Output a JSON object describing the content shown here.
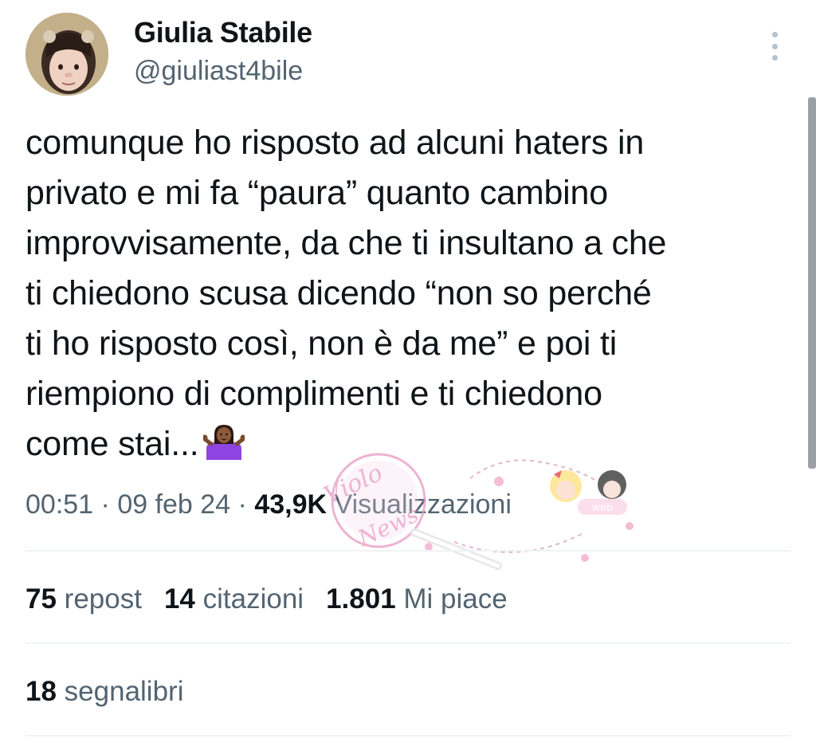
{
  "author": {
    "display_name": "Giulia Stabile",
    "handle": "@giuliast4bile"
  },
  "tweet": {
    "lines": [
      "comunque ho risposto ad alcuni haters in",
      "privato e mi fa “paura” quanto cambino",
      "improvvisamente, da che ti insultano a che",
      "ti chiedono scusa dicendo “non so perché",
      "ti ho risposto così, non è da me” e poi ti",
      "riempiono di complimenti e ti chiedono",
      "come stai..."
    ],
    "emoji": "person-shrugging-emoji"
  },
  "meta": {
    "time": "00:51",
    "separator": " · ",
    "date": "09 feb 24",
    "views_count": "43,9K",
    "views_label": "Visualizzazioni"
  },
  "stats": {
    "reposts": {
      "count": "75",
      "label": "repost"
    },
    "quotes": {
      "count": "14",
      "label": "citazioni"
    },
    "likes": {
      "count": "1.801",
      "label": "Mi piace"
    },
    "bookmarks": {
      "count": "18",
      "label": "segnalibri"
    }
  },
  "watermark": {
    "line1": "Violo",
    "line2": "News",
    "badge": "web"
  },
  "icons": {
    "more": "more-vertical-icon",
    "avatar": "avatar"
  },
  "colors": {
    "text": "#0f1419",
    "secondary": "#536471",
    "divider": "#eff3f4",
    "more_dots": "#b6c2cc",
    "watermark_pink": "#e79ac4"
  }
}
